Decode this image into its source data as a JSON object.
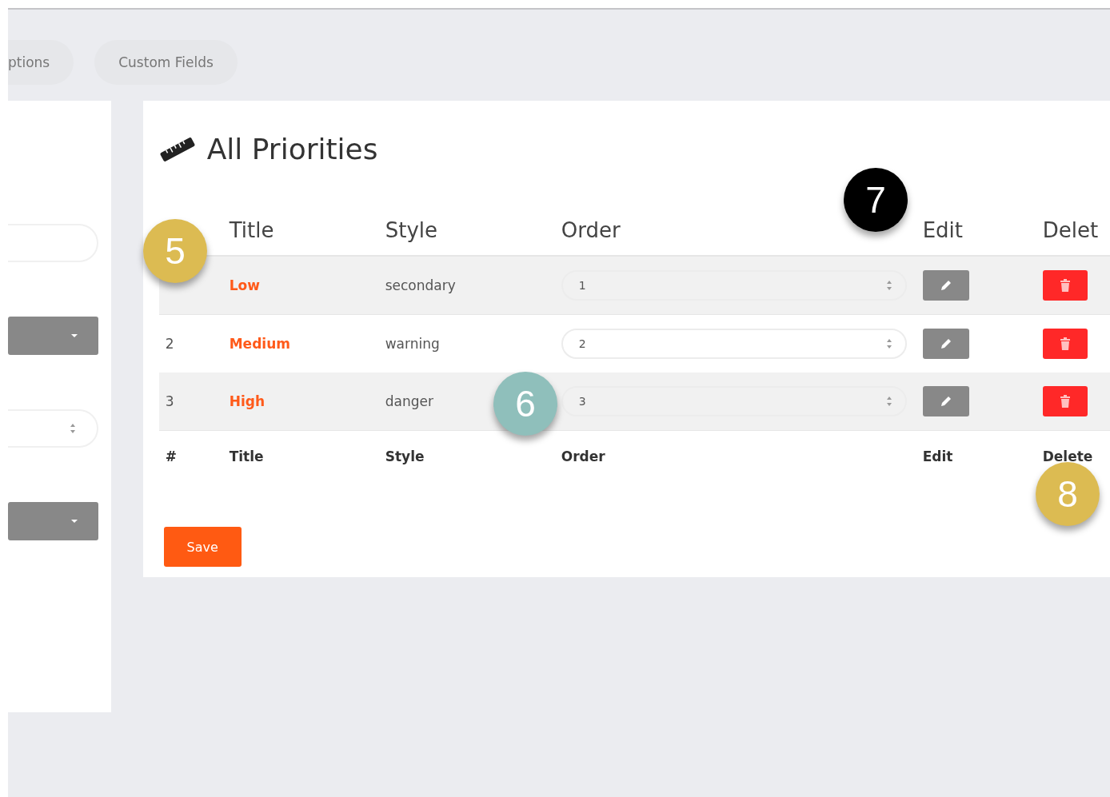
{
  "tabs": [
    {
      "label": "ptions"
    },
    {
      "label": "Custom Fields"
    }
  ],
  "side_panel": {
    "fields": [
      {
        "kind": "text"
      },
      {
        "kind": "select"
      },
      {
        "kind": "number"
      },
      {
        "kind": "select"
      }
    ]
  },
  "card": {
    "title": "All Priorities",
    "header": [
      {
        "label": "Title"
      },
      {
        "label": "Style"
      },
      {
        "label": "Order"
      },
      {
        "label": "Edit"
      },
      {
        "label": "Delet"
      }
    ],
    "rows": [
      {
        "title": "Low",
        "style": "secondary",
        "order": "1"
      },
      {
        "number": "2",
        "title": "Medium",
        "style": "warning",
        "order": "2"
      },
      {
        "number": "3",
        "title": "High",
        "style": "danger",
        "order": "3"
      }
    ],
    "footer": [
      "#",
      "Title",
      "Style",
      "Order",
      "Edit",
      "Delete"
    ],
    "save_button": "Save"
  },
  "callouts": [
    {
      "label": "5",
      "color": "#dcbb52"
    },
    {
      "label": "6",
      "color": "#8fbfbb"
    },
    {
      "label": "7",
      "color": "#000000"
    },
    {
      "label": "8",
      "color": "#dcbb52"
    }
  ]
}
